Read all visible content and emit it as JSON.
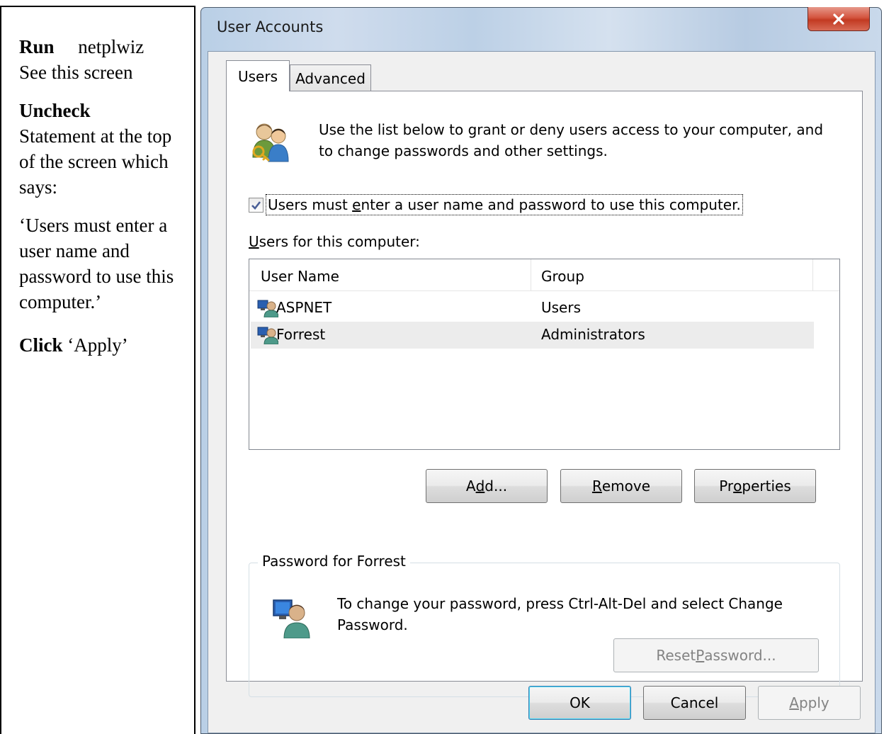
{
  "instructions": {
    "run_label": "Run",
    "run_cmd": "netplwiz",
    "see_text": "See this screen",
    "uncheck_label": "Uncheck",
    "statement_text": "Statement at the top of the screen which says:",
    "quote_text": "‘Users must enter a user name and password to use this computer.’",
    "click_label": "Click",
    "click_target": "‘Apply’"
  },
  "window": {
    "title": "User Accounts",
    "close_icon": "close-x-icon"
  },
  "tabs": [
    {
      "label": "Users",
      "selected": true
    },
    {
      "label": "Advanced",
      "selected": false
    }
  ],
  "intro": {
    "icon": "users-key-icon",
    "text": "Use the list below to grant or deny users access to your computer, and to change passwords and other settings."
  },
  "require_login": {
    "checked": true,
    "label_pre": "Users must ",
    "label_accel": "e",
    "label_post": "nter a user name and password to use this computer."
  },
  "users_list": {
    "label_accel": "U",
    "label_rest": "sers for this computer:",
    "columns": [
      "User Name",
      "Group"
    ],
    "rows": [
      {
        "name": "ASPNET",
        "group": "Users",
        "selected": false
      },
      {
        "name": "Forrest",
        "group": "Administrators",
        "selected": true
      }
    ]
  },
  "list_buttons": {
    "add_pre": "A",
    "add_accel": "d",
    "add_post": "d...",
    "remove_pre": "",
    "remove_accel": "R",
    "remove_post": "emove",
    "props_pre": "Pr",
    "props_accel": "o",
    "props_post": "perties"
  },
  "password_group": {
    "title": "Password for Forrest",
    "icon": "user-computer-icon",
    "text": "To change your password, press Ctrl-Alt-Del and select Change Password.",
    "reset_pre": "Reset ",
    "reset_accel": "P",
    "reset_post": "assword..."
  },
  "dialog_buttons": {
    "ok": "OK",
    "cancel": "Cancel",
    "apply_accel": "A",
    "apply_post": "pply"
  }
}
